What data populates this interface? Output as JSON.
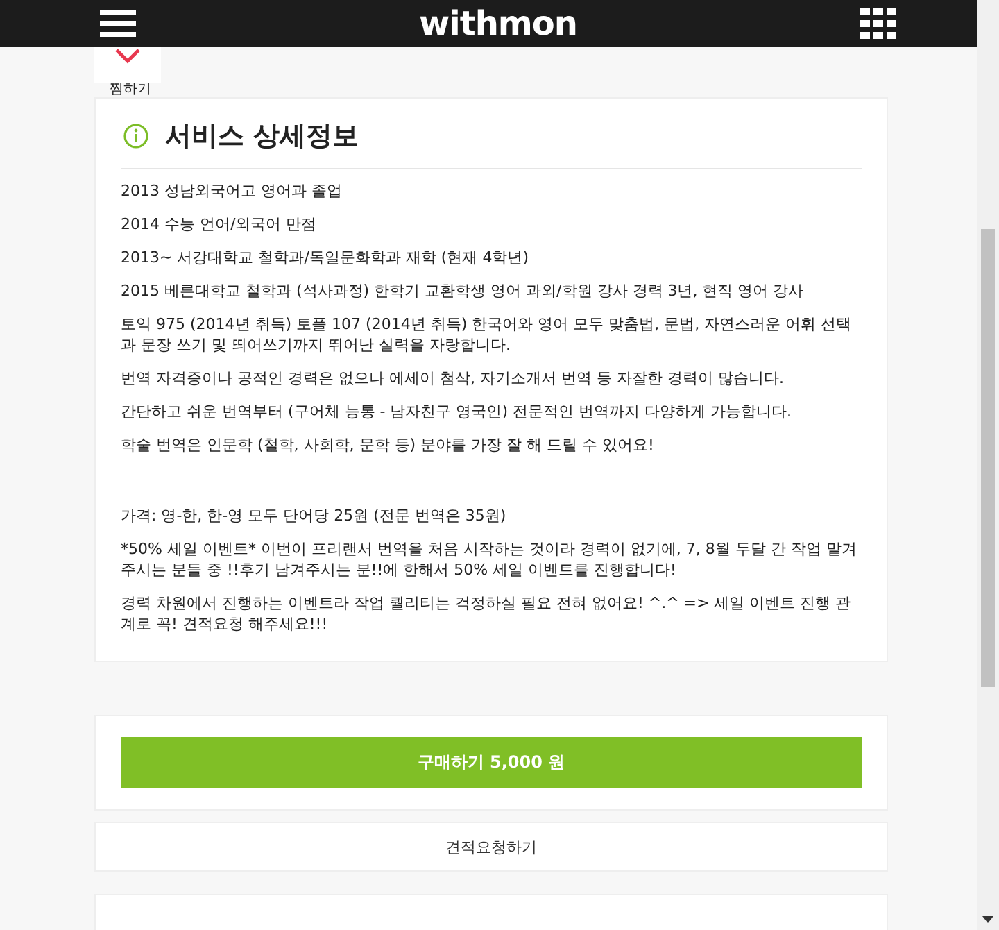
{
  "header": {
    "logo": "withmon"
  },
  "wish": {
    "label": "찜하기"
  },
  "detail": {
    "title": "서비스 상세정보",
    "paragraphs": [
      {
        "kind": "plain",
        "text": "2013 성남외국어고 영어과 졸업"
      },
      {
        "kind": "plain",
        "text": "2014 수능 언어/외국어 만점"
      },
      {
        "kind": "plain",
        "text": "2013~ 서강대학교 철학과/독일문화학과 재학 (현재 4학년)"
      },
      {
        "kind": "plain",
        "text": "2015 베른대학교 철학과 (석사과정) 한학기 교환학생 영어 과외/학원 강사 경력 3년, 현직 영어 강사"
      },
      {
        "kind": "plain",
        "text": "토익 975 (2014년 취득) 토플 107 (2014년 취득) 한국어와 영어 모두 맞춤법, 문법, 자연스러운 어휘 선택과 문장 쓰기 및 띄어쓰기까지 뛰어난 실력을 자랑합니다."
      },
      {
        "kind": "plain",
        "text": "번역 자격증이나 공적인 경력은 없으나 에세이 첨삭, 자기소개서 번역 등 자잘한 경력이 많습니다."
      },
      {
        "kind": "plain",
        "text": "간단하고 쉬운 번역부터 (구어체 능통 - 남자친구 영국인) 전문적인 번역까지 다양하게 가능합니다."
      },
      {
        "kind": "plain",
        "text": "학술 번역은 인문학 (철학, 사회학, 문학 등) 분야를 가장 잘 해 드릴 수 있어요!"
      },
      {
        "kind": "spaced",
        "text": "가격: 영-한, 한-영 모두 단어당 25원 (전문 번역은 35원)"
      },
      {
        "kind": "plain",
        "text": "*50% 세일 이벤트* 이번이 프리랜서 번역을 처음 시작하는 것이라 경력이 없기에, 7, 8월 두달 간 작업 맡겨주시는 분들 중 !!후기 남겨주시는 분!!에 한해서 50% 세일 이벤트를 진행합니다!"
      },
      {
        "kind": "plain",
        "text": "경력 차원에서 진행하는 이벤트라 작업 퀄리티는 걱정하실 필요 전혀 없어요! ^.^ => 세일 이벤트 진행 관계로 꼭! 견적요청 해주세요!!!"
      }
    ]
  },
  "buy_button": "구매하기 5,000 원",
  "quote_button": "견적요청하기"
}
